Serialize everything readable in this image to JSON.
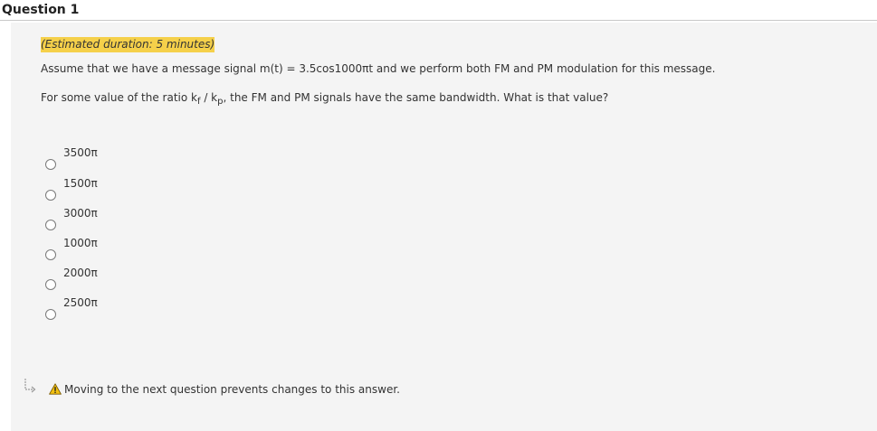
{
  "question": {
    "title": "Question 1",
    "duration": "(Estimated duration: 5 minutes)",
    "line1": "Assume that we have a message signal m(t) = 3.5cos1000πt and we perform both FM and PM modulation for this message.",
    "line2_prefix": "For some value of the ratio k",
    "line2_sub_f": "f",
    "line2_mid": " / k",
    "line2_sub_p": "p",
    "line2_suffix": ", the FM and PM signals have the same bandwidth. What is that value?"
  },
  "options": [
    {
      "label": "3500π"
    },
    {
      "label": "1500π"
    },
    {
      "label": "3000π"
    },
    {
      "label": "1000π"
    },
    {
      "label": "2000π"
    },
    {
      "label": "2500π"
    }
  ],
  "footer": {
    "warning": "Moving to the next question prevents changes to this answer.",
    "warning_icon": "warning-icon",
    "arrow_icon": "arrow-icon"
  }
}
